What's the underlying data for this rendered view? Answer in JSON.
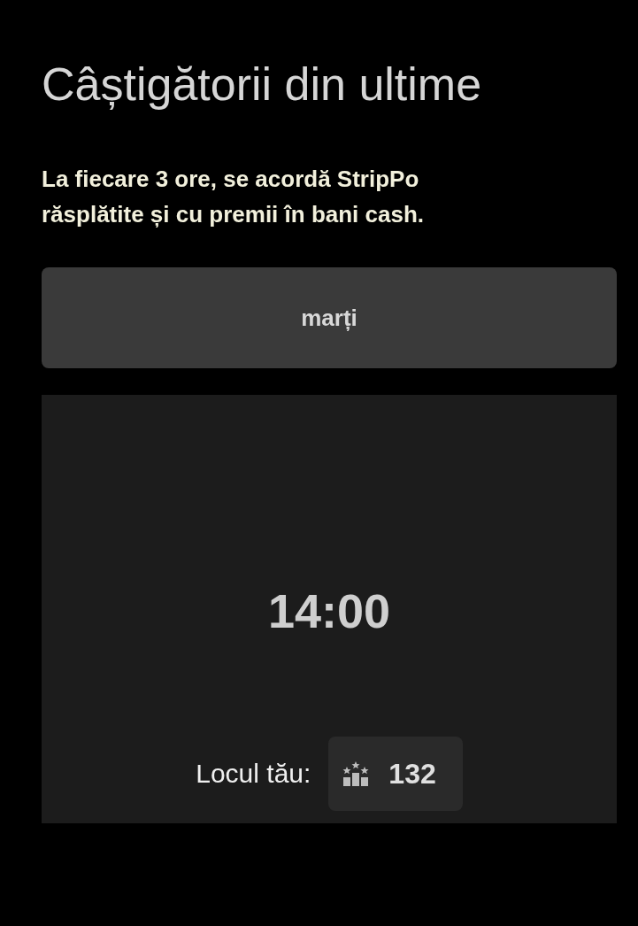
{
  "title": "Câștigătorii din ultime",
  "description": [
    "La fiecare 3 ore, se acordă StripPo",
    "răsplătite și cu premii în bani cash."
  ],
  "day_button": {
    "label": "marți"
  },
  "card": {
    "time": "14:00",
    "place_label": "Locul tău:",
    "place_value": "132"
  }
}
